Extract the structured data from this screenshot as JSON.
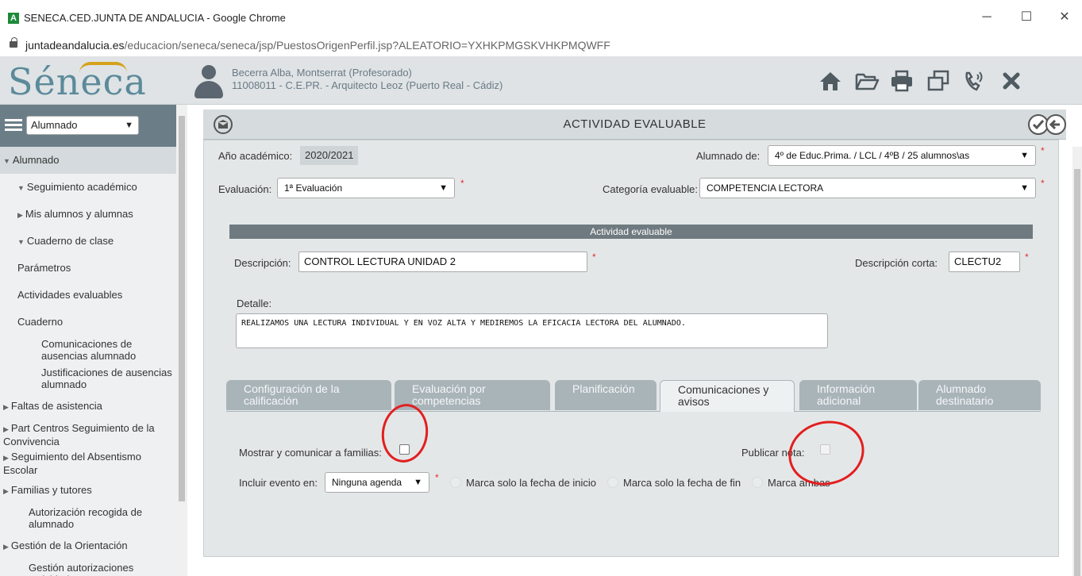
{
  "browser": {
    "window_title": "SENECA.CED.JUNTA DE ANDALUCIA - Google Chrome",
    "favicon_letter": "A",
    "url_domain": "juntadeandalucia.es",
    "url_path": "/educacion/seneca/seneca/jsp/PuestosOrigenPerfil.jsp?ALEATORIO=YXHKPMGSKVHKPMQWFF",
    "min_label": "─",
    "max_label": "☐",
    "close_label": "✕"
  },
  "header": {
    "logo": "Séneca",
    "user_name": "Becerra Alba, Montserrat (Profesorado)",
    "user_center": "11008011 - C.E.PR. - Arquitecto Leoz (Puerto Real - Cádiz)",
    "icons": [
      "home-icon",
      "folder-open-icon",
      "print-icon",
      "copy-windows-icon",
      "phone-icon",
      "close-x-icon"
    ]
  },
  "sidebar": {
    "section_select": "Alumnado",
    "items": [
      {
        "label": "Alumnado",
        "indent": 0,
        "tri": "▼",
        "active": true
      },
      {
        "label": "Seguimiento académico",
        "indent": 1,
        "tri": "▼"
      },
      {
        "label": "Mis alumnos y alumnas",
        "indent": 2,
        "tri": "▶"
      },
      {
        "label": "Cuaderno de clase",
        "indent": 2,
        "tri": "▼"
      },
      {
        "label": "Parámetros",
        "indent": 3,
        "tri": ""
      },
      {
        "label": "Actividades evaluables",
        "indent": 3,
        "tri": ""
      },
      {
        "label": "Cuaderno",
        "indent": 3,
        "tri": ""
      },
      {
        "label": "Comunicaciones de ausencias alumnado",
        "indent": 4,
        "tri": ""
      },
      {
        "label": "Justificaciones de ausencias alumnado",
        "indent": 4,
        "tri": ""
      },
      {
        "label": "Faltas de asistencia",
        "indent": 0,
        "tri": "▶"
      },
      {
        "label": "Part Centros Seguimiento de la Convivencia",
        "indent": 0,
        "tri": "▶"
      },
      {
        "label": "Seguimiento del Absentismo Escolar",
        "indent": 0,
        "tri": "▶"
      },
      {
        "label": "Familias y tutores",
        "indent": 0,
        "tri": "▶"
      },
      {
        "label": "Autorización recogida de alumnado",
        "indent": 5,
        "tri": ""
      },
      {
        "label": "Gestión de la Orientación",
        "indent": 0,
        "tri": "▶"
      },
      {
        "label": "Gestión autorizaciones actividades",
        "indent": 5,
        "tri": ""
      }
    ]
  },
  "main": {
    "title": "ACTIVIDAD EVALUABLE",
    "anio_label": "Año académico:",
    "anio_value": "2020/2021",
    "alumnado_label": "Alumnado de:",
    "alumnado_value": "4º de Educ.Prima. / LCL / 4ºB / 25 alumnos\\as",
    "evaluacion_label": "Evaluación:",
    "evaluacion_value": "1ª Evaluación",
    "categoria_label": "Categoría evaluable:",
    "categoria_value": "COMPETENCIA LECTORA",
    "section_title": "Actividad evaluable",
    "descripcion_label": "Descripción:",
    "descripcion_value": "CONTROL LECTURA UNIDAD  2",
    "desc_corta_label": "Descripción corta:",
    "desc_corta_value": "CLECTU2",
    "detalle_label": "Detalle:",
    "detalle_value": "REALIZAMOS UNA LECTURA INDIVIDUAL Y EN VOZ ALTA Y MEDIREMOS LA EFICACIA LECTORA DEL ALUMNADO.",
    "required_mark": "*",
    "tabs": [
      {
        "label": "Configuración de la calificación",
        "selected": false
      },
      {
        "label": "Evaluación por competencias",
        "selected": false
      },
      {
        "label": "Planificación",
        "selected": false
      },
      {
        "label": "Comunicaciones y avisos",
        "selected": true
      },
      {
        "label": "Información adicional",
        "selected": false
      },
      {
        "label": "Alumnado destinatario",
        "selected": false
      }
    ],
    "mostrar_label": "Mostrar y comunicar a familias:",
    "mostrar_checked": false,
    "publicar_label": "Publicar nota:",
    "publicar_checked": false,
    "incluir_label": "Incluir evento en:",
    "incluir_value": "Ninguna agenda",
    "radio_inicio": "Marca solo la fecha de inicio",
    "radio_fin": "Marca solo la fecha de fin",
    "radio_ambas": "Marca ambas"
  },
  "colors": {
    "annotation": "#e21f1f",
    "sidebar_header": "#6b7e87",
    "tab_inactive": "#a9b4b9",
    "section_bar": "#6f7a80"
  }
}
